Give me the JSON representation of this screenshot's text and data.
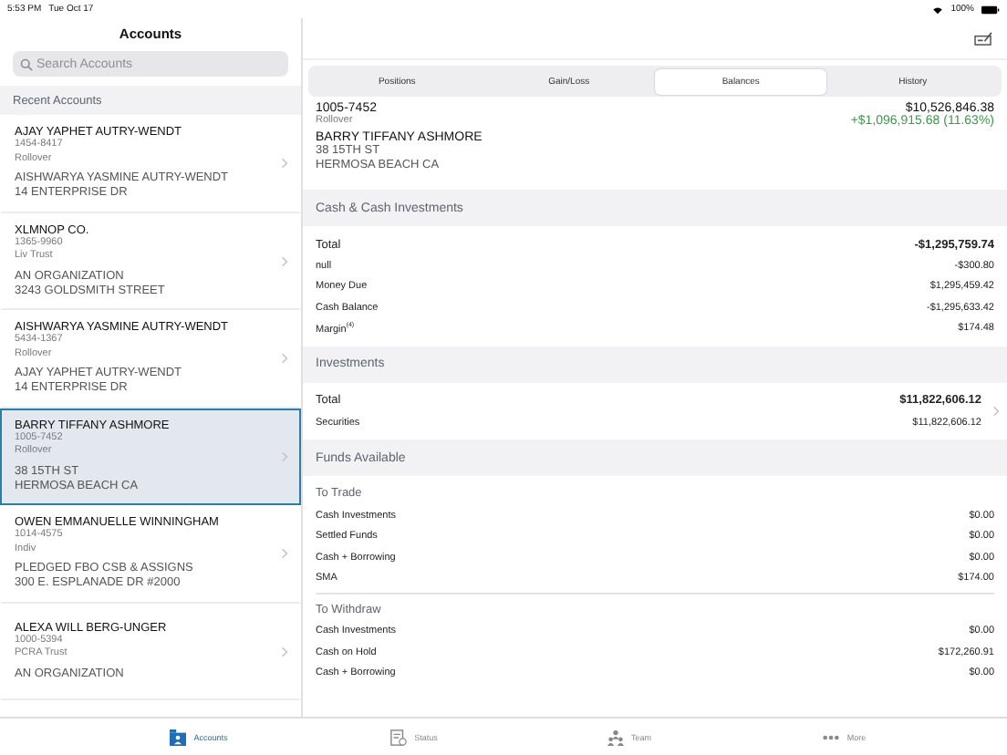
{
  "status_bar": {
    "time": "5:53 PM",
    "date": "Tue Oct 17",
    "battery_text": "100%"
  },
  "sidebar": {
    "title": "Accounts",
    "search": {
      "placeholder": "Search Accounts"
    },
    "section": "Recent Accounts",
    "accounts": [
      {
        "name": "AJAY YAPHET AUTRY-WENDT",
        "number": "1454-8417",
        "type": "Rollover",
        "address": [
          "AISHWARYA YASMINE AUTRY-WENDT",
          "14 ENTERPRISE DR"
        ],
        "selected": false
      },
      {
        "name": "XLMNOP CO.",
        "number": "1365-9960",
        "type": "Liv Trust",
        "address": [
          "AN ORGANIZATION",
          "3243 GOLDSMITH STREET"
        ],
        "selected": false
      },
      {
        "name": "AISHWARYA YASMINE AUTRY-WENDT",
        "number": "5434-1367",
        "type": "Rollover",
        "address": [
          "AJAY YAPHET AUTRY-WENDT",
          "14 ENTERPRISE DR"
        ],
        "selected": false
      },
      {
        "name": "BARRY TIFFANY ASHMORE",
        "number": "1005-7452",
        "type": "Rollover",
        "address": [
          "38 15TH ST",
          "HERMOSA BEACH CA"
        ],
        "selected": true
      },
      {
        "name": "OWEN EMMANUELLE WINNINGHAM",
        "number": "1014-4575",
        "type": "Indiv",
        "address": [
          "PLEDGED FBO CSB & ASSIGNS",
          "300 E. ESPLANADE DR #2000"
        ],
        "selected": false
      },
      {
        "name": "ALEXA WILL BERG-UNGER",
        "number": "1000-5394",
        "type": "PCRA Trust",
        "address": [
          "AN ORGANIZATION"
        ],
        "selected": false
      }
    ]
  },
  "tabs": [
    {
      "label": "Positions",
      "selected": false
    },
    {
      "label": "Gain/Loss",
      "selected": false
    },
    {
      "label": "Balances",
      "selected": true
    },
    {
      "label": "History",
      "selected": false
    }
  ],
  "account": {
    "number": "1005-7452",
    "type": "Rollover",
    "name": "BARRY TIFFANY ASHMORE",
    "address": [
      "38 15TH ST",
      "HERMOSA BEACH CA"
    ],
    "value": "$10,526,846.38",
    "change": "+$1,096,915.68 (11.63%)"
  },
  "sections": [
    {
      "title": "Cash & Cash Investments",
      "chevron": false,
      "groups": [
        {
          "rows": [
            {
              "label": "Total",
              "value": "-$1,295,759.74",
              "kind": "total"
            },
            {
              "label": "null",
              "value": "-$300.80",
              "kind": "item"
            },
            {
              "label": "Money Due",
              "value": "$1,295,459.42",
              "kind": "item"
            },
            {
              "label": "Cash Balance",
              "value": "-$1,295,633.42",
              "kind": "item"
            },
            {
              "label": "Margin$^{(4)}$",
              "value": "$174.48",
              "kind": "item"
            }
          ]
        }
      ]
    },
    {
      "title": "Investments",
      "chevron": true,
      "groups": [
        {
          "rows": [
            {
              "label": "Total",
              "value": "$11,822,606.12",
              "kind": "total"
            },
            {
              "label": "Securities",
              "value": "$11,822,606.12",
              "kind": "item"
            }
          ]
        }
      ]
    },
    {
      "title": "Funds Available",
      "chevron": false,
      "groups": [
        {
          "heading": "To Trade",
          "rows": [
            {
              "label": "Cash Investments",
              "value": "$0.00",
              "kind": "item"
            },
            {
              "label": "Settled Funds",
              "value": "$0.00",
              "kind": "item"
            },
            {
              "label": "Cash + Borrowing",
              "value": "$0.00",
              "kind": "item"
            },
            {
              "label": "SMA",
              "value": "$174.00",
              "kind": "item"
            }
          ]
        },
        {
          "heading": "To Withdraw",
          "rows": [
            {
              "label": "Cash Investments",
              "value": "$0.00",
              "kind": "item"
            },
            {
              "label": "Cash on Hold",
              "value": "$172,260.91",
              "kind": "item"
            },
            {
              "label": "Cash + Borrowing",
              "value": "$0.00",
              "kind": "item"
            }
          ]
        }
      ]
    }
  ],
  "tab_bar": [
    {
      "label": "Accounts",
      "kind": "accounts",
      "selected": true
    },
    {
      "label": "Status",
      "kind": "status",
      "selected": false
    },
    {
      "label": "Team",
      "kind": "team",
      "selected": false
    },
    {
      "label": "More",
      "kind": "more",
      "selected": false
    }
  ]
}
